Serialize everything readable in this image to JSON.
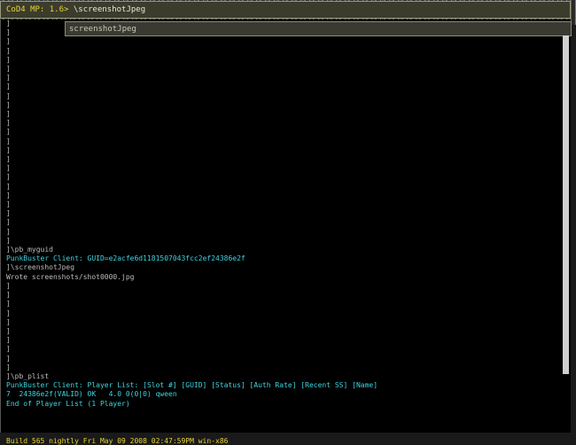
{
  "input": {
    "prompt": "CoD4 MP: 1.6>",
    "command": " \\screenshotJpeg"
  },
  "autocomplete": {
    "suggestion": "screenshotJpeg"
  },
  "console": {
    "lines": [
      {
        "text": "]",
        "color": "gray"
      },
      {
        "text": "]",
        "color": "gray"
      },
      {
        "text": "]",
        "color": "gray"
      },
      {
        "text": "]",
        "color": "gray"
      },
      {
        "text": "]",
        "color": "gray"
      },
      {
        "text": "]",
        "color": "gray"
      },
      {
        "text": "]",
        "color": "gray"
      },
      {
        "text": "]",
        "color": "gray"
      },
      {
        "text": "]",
        "color": "gray"
      },
      {
        "text": "]",
        "color": "gray"
      },
      {
        "text": "]",
        "color": "gray"
      },
      {
        "text": "]",
        "color": "gray"
      },
      {
        "text": "]",
        "color": "gray"
      },
      {
        "text": "]",
        "color": "gray"
      },
      {
        "text": "]",
        "color": "gray"
      },
      {
        "text": "]",
        "color": "gray"
      },
      {
        "text": "]",
        "color": "gray"
      },
      {
        "text": "]",
        "color": "gray"
      },
      {
        "text": "]",
        "color": "gray"
      },
      {
        "text": "]",
        "color": "gray"
      },
      {
        "text": "]",
        "color": "gray"
      },
      {
        "text": "]",
        "color": "gray"
      },
      {
        "text": "]",
        "color": "gray"
      },
      {
        "text": "]",
        "color": "gray"
      },
      {
        "text": "]",
        "color": "gray"
      },
      {
        "text": "]\\pb_myguid",
        "color": "gray"
      },
      {
        "text": "PunkBuster Client: GUID=e2acfe6d1181507043fcc2ef24386e2f",
        "color": "cyan"
      },
      {
        "text": "]\\screenshotJpeg",
        "color": "gray"
      },
      {
        "text": "Wrote screenshots/shot0000.jpg",
        "color": "gray"
      },
      {
        "text": "]",
        "color": "gray"
      },
      {
        "text": "]",
        "color": "gray"
      },
      {
        "text": "]",
        "color": "gray"
      },
      {
        "text": "]",
        "color": "gray"
      },
      {
        "text": "]",
        "color": "gray"
      },
      {
        "text": "]",
        "color": "gray"
      },
      {
        "text": "]",
        "color": "gray"
      },
      {
        "text": "]",
        "color": "gray"
      },
      {
        "text": "]",
        "color": "gray"
      },
      {
        "text": "]",
        "color": "gray"
      },
      {
        "text": "]\\pb_plist",
        "color": "gray"
      },
      {
        "text": "PunkBuster Client: Player List: [Slot #] [GUID] [Status] [Auth Rate] [Recent SS] [Name]",
        "color": "cyan"
      },
      {
        "text": "7  24386e2f(VALID) OK   4.0 0(0|0) qween",
        "color": "cyan"
      },
      {
        "text": "End of Player List (1 Player)",
        "color": "cyan"
      }
    ],
    "build": "Build 565 nightly Fri May 09 2008 02:47:59PM win-x86"
  },
  "colors": {
    "gray": "#bdbdbd",
    "cyan": "#3fd3e0",
    "yellow": "#e6d33a",
    "background": "#000000"
  }
}
